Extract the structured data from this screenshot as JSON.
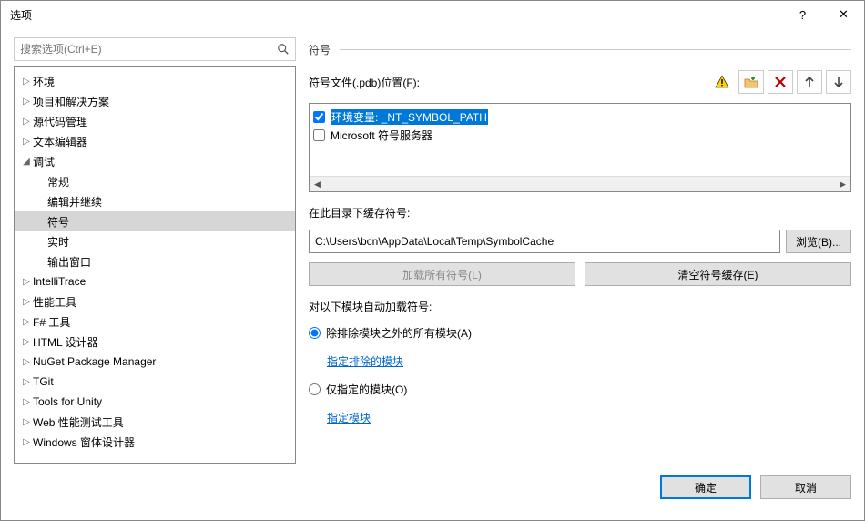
{
  "window": {
    "title": "选项"
  },
  "search": {
    "placeholder": "搜索选项(Ctrl+E)"
  },
  "tree": [
    {
      "label": "环境",
      "d": 0,
      "exp": "▷"
    },
    {
      "label": "项目和解决方案",
      "d": 0,
      "exp": "▷"
    },
    {
      "label": "源代码管理",
      "d": 0,
      "exp": "▷"
    },
    {
      "label": "文本编辑器",
      "d": 0,
      "exp": "▷"
    },
    {
      "label": "调试",
      "d": 0,
      "exp": "◢"
    },
    {
      "label": "常规",
      "d": 1,
      "exp": ""
    },
    {
      "label": "编辑并继续",
      "d": 1,
      "exp": ""
    },
    {
      "label": "符号",
      "d": 1,
      "exp": "",
      "sel": true
    },
    {
      "label": "实时",
      "d": 1,
      "exp": ""
    },
    {
      "label": "输出窗口",
      "d": 1,
      "exp": ""
    },
    {
      "label": "IntelliTrace",
      "d": 0,
      "exp": "▷"
    },
    {
      "label": "性能工具",
      "d": 0,
      "exp": "▷"
    },
    {
      "label": "F# 工具",
      "d": 0,
      "exp": "▷"
    },
    {
      "label": "HTML 设计器",
      "d": 0,
      "exp": "▷"
    },
    {
      "label": "NuGet Package Manager",
      "d": 0,
      "exp": "▷"
    },
    {
      "label": "TGit",
      "d": 0,
      "exp": "▷"
    },
    {
      "label": "Tools for Unity",
      "d": 0,
      "exp": "▷"
    },
    {
      "label": "Web 性能测试工具",
      "d": 0,
      "exp": "▷"
    },
    {
      "label": "Windows 窗体设计器",
      "d": 0,
      "exp": "▷"
    }
  ],
  "panel": {
    "header": "符号",
    "locations_label": "符号文件(.pdb)位置(F):",
    "items": [
      {
        "checked": true,
        "selected": true,
        "text": "环境变量:  _NT_SYMBOL_PATH"
      },
      {
        "checked": false,
        "selected": false,
        "text": "Microsoft 符号服务器"
      }
    ],
    "cache_label": "在此目录下缓存符号:",
    "cache_path": "C:\\Users\\bcn\\AppData\\Local\\Temp\\SymbolCache",
    "browse": "浏览(B)...",
    "load_all": "加载所有符号(L)",
    "empty_cache": "清空符号缓存(E)",
    "auto_load_label": "对以下模块自动加载符号:",
    "radio1": "除排除模块之外的所有模块(A)",
    "link1": "指定排除的模块",
    "radio2": "仅指定的模块(O)",
    "link2": "指定模块"
  },
  "footer": {
    "ok": "确定",
    "cancel": "取消"
  }
}
